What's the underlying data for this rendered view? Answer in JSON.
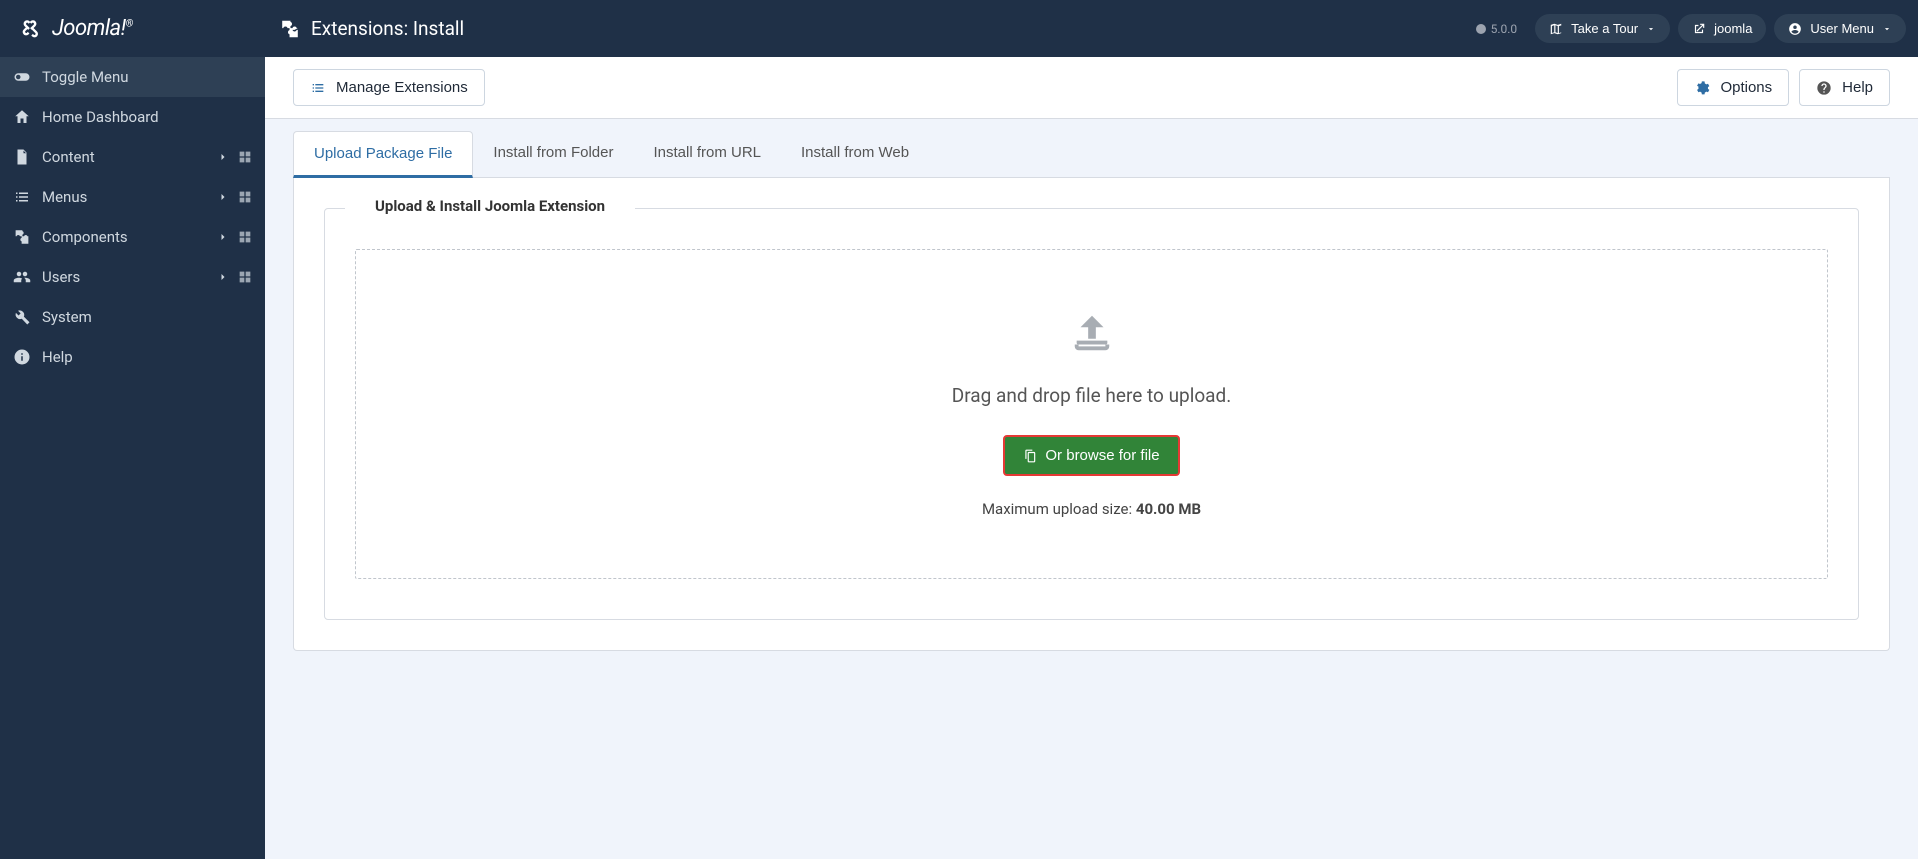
{
  "header": {
    "page_title": "Extensions: Install",
    "version": "5.0.0",
    "take_tour": "Take a Tour",
    "site_name": "joomla",
    "user_menu": "User Menu"
  },
  "sidebar": {
    "toggle": "Toggle Menu",
    "items": [
      {
        "label": "Home Dashboard",
        "icon": "home",
        "has_sub": false,
        "has_quick": false
      },
      {
        "label": "Content",
        "icon": "file",
        "has_sub": true,
        "has_quick": true
      },
      {
        "label": "Menus",
        "icon": "list",
        "has_sub": true,
        "has_quick": true
      },
      {
        "label": "Components",
        "icon": "puzzle",
        "has_sub": true,
        "has_quick": true
      },
      {
        "label": "Users",
        "icon": "users",
        "has_sub": true,
        "has_quick": true
      },
      {
        "label": "System",
        "icon": "wrench",
        "has_sub": false,
        "has_quick": false
      },
      {
        "label": "Help",
        "icon": "info",
        "has_sub": false,
        "has_quick": false
      }
    ]
  },
  "toolbar": {
    "manage": "Manage Extensions",
    "options": "Options",
    "help": "Help"
  },
  "tabs": [
    {
      "label": "Upload Package File",
      "active": true
    },
    {
      "label": "Install from Folder",
      "active": false
    },
    {
      "label": "Install from URL",
      "active": false
    },
    {
      "label": "Install from Web",
      "active": false
    }
  ],
  "upload": {
    "legend": "Upload & Install Joomla Extension",
    "drop_text": "Drag and drop file here to upload.",
    "browse_label": "Or browse for file",
    "max_label": "Maximum upload size: ",
    "max_value": "40.00 MB"
  }
}
